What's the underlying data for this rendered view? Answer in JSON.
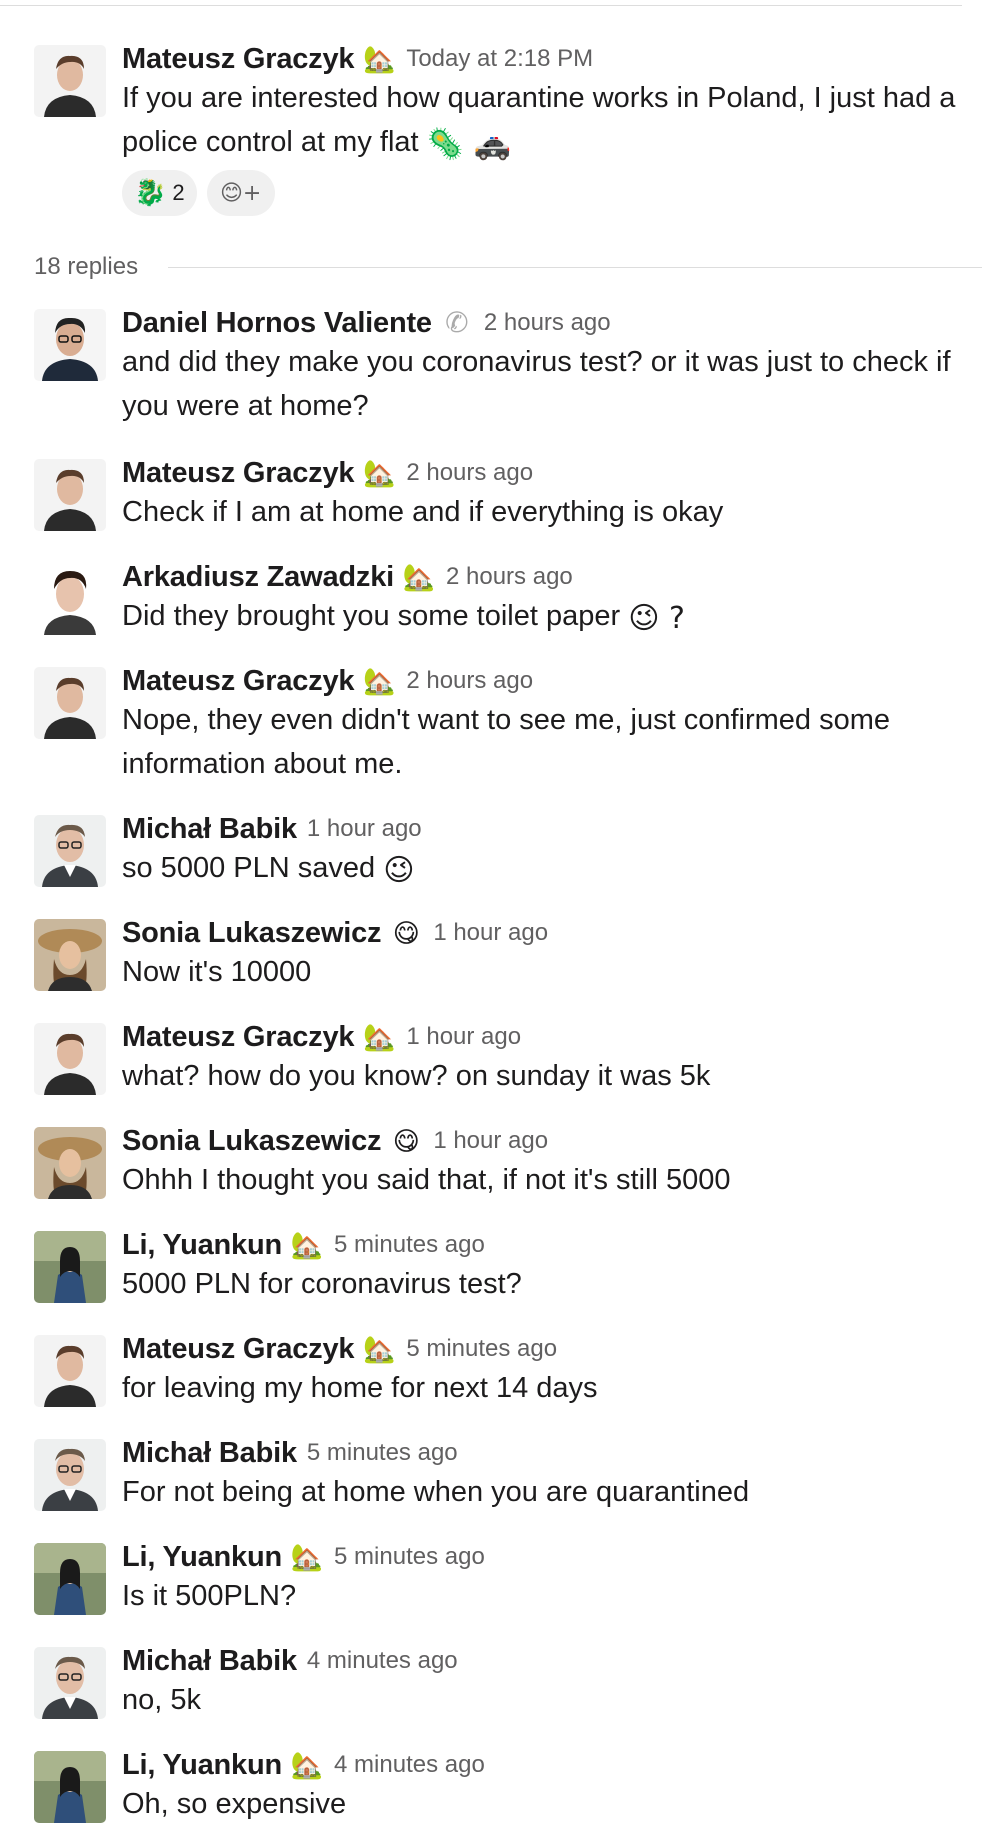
{
  "parent": {
    "author": "Mateusz Graczyk",
    "status_icon": "🏡",
    "time": "Today at 2:18 PM",
    "text": "If you are interested how quarantine works in Poland, I just had a police control at my flat",
    "text_emojis": "🦠 🚓",
    "reactions": [
      {
        "emoji": "🐉",
        "count": "2"
      }
    ],
    "add_reaction_icon": "😊+"
  },
  "thread": {
    "replies_label": "18 replies"
  },
  "replies": [
    {
      "author": "Daniel Hornos Valiente",
      "status_icon": "📞",
      "time": "2 hours ago",
      "text": "and did they make you coronavirus test? or it was just to check if you were at home?"
    },
    {
      "author": "Mateusz Graczyk",
      "status_icon": "🏡",
      "time": "2 hours ago",
      "text": "Check if I am at home and if everything is okay"
    },
    {
      "author": "Arkadiusz Zawadzki",
      "status_icon": "🏡",
      "time": "2 hours ago",
      "text": "Did they brought you some toilet paper",
      "text_emojis": "😉 ?"
    },
    {
      "author": "Mateusz Graczyk",
      "status_icon": "🏡",
      "time": "2 hours ago",
      "text": "Nope, they even didn't want to see me, just confirmed some information about me."
    },
    {
      "author": "Michał Babik",
      "status_icon": "",
      "time": "1 hour ago",
      "text": "so 5000 PLN saved",
      "text_emojis": "😉"
    },
    {
      "author": "Sonia Lukaszewicz",
      "status_icon": "😋",
      "time": "1 hour ago",
      "text": "Now it's 10000"
    },
    {
      "author": "Mateusz Graczyk",
      "status_icon": "🏡",
      "time": "1 hour ago",
      "text": "what? how do you know? on sunday it was 5k"
    },
    {
      "author": "Sonia Lukaszewicz",
      "status_icon": "😋",
      "time": "1 hour ago",
      "text": "Ohhh I thought you said that, if not it's still 5000"
    },
    {
      "author": "Li, Yuankun",
      "status_icon": "🏡",
      "time": "5 minutes ago",
      "text": "5000 PLN for coronavirus test?"
    },
    {
      "author": "Mateusz Graczyk",
      "status_icon": "🏡",
      "time": "5 minutes ago",
      "text": "for leaving my home for next 14 days"
    },
    {
      "author": "Michał Babik",
      "status_icon": "",
      "time": "5 minutes ago",
      "text": "For not being at home when you are quarantined"
    },
    {
      "author": "Li, Yuankun",
      "status_icon": "🏡",
      "time": "5 minutes ago",
      "text": "Is it 500PLN?"
    },
    {
      "author": "Michał Babik",
      "status_icon": "",
      "time": "4 minutes ago",
      "text": "no, 5k"
    },
    {
      "author": "Li, Yuankun",
      "status_icon": "🏡",
      "time": "4 minutes ago",
      "text": "Oh, so expensive"
    }
  ]
}
